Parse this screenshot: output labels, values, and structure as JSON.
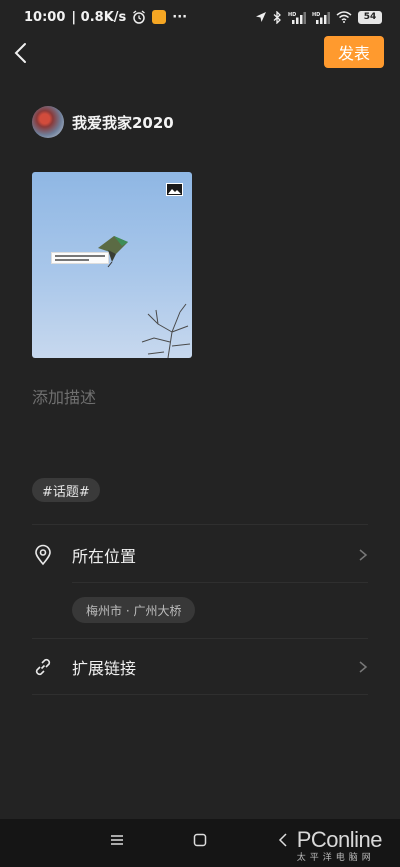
{
  "status_bar": {
    "time": "10:00",
    "speed": "| 0.8K/s",
    "more": "···",
    "battery": "54"
  },
  "header": {
    "publish_label": "发表"
  },
  "user": {
    "name": "我爱我家2020"
  },
  "post": {
    "description_placeholder": "添加描述",
    "topic_tag": "#话题#"
  },
  "options": {
    "location_label": "所在位置",
    "location_value": "梅州市 · 广州大桥",
    "link_label": "扩展链接"
  },
  "watermark": {
    "brand": "PConline",
    "sub": "太平洋电脑网"
  },
  "colors": {
    "background": "#232323",
    "accent": "#ff9a2e",
    "chip": "#3a3a3a"
  }
}
